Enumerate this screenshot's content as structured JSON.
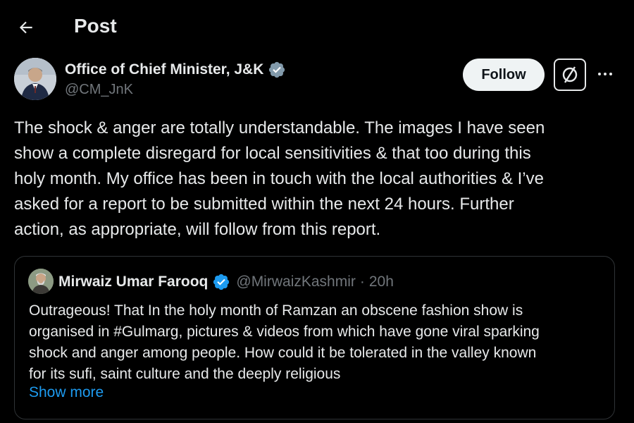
{
  "header": {
    "title": "Post",
    "back_icon": "arrow-left-icon"
  },
  "author": {
    "name": "Office of Chief Minister, J&K",
    "handle": "@CM_JnK",
    "verified_icon": "verified-badge-icon",
    "verified_color": "#829aab"
  },
  "actions": {
    "follow_label": "Follow",
    "grok_icon": "grok-icon",
    "more_icon": "more-dots-icon"
  },
  "post": {
    "lines": [
      "The shock & anger are totally understandable. The images I have seen",
      "show a complete disregard for local sensitivities & that too during this",
      "holy month. My office has been in touch with the local authorities & I’ve",
      "asked for a report to be submitted within the next 24 hours. Further",
      "action, as appropriate, will follow from this report."
    ]
  },
  "quote": {
    "name": "Mirwaiz Umar Farooq",
    "verified_color": "#1d9bf0",
    "handle": "@MirwaizKashmir",
    "separator": "·",
    "time": "20h",
    "lines": [
      "Outrageous! That In the holy month of Ramzan an obscene fashion show is",
      "organised in #Gulmarg, pictures & videos from which have gone viral sparking",
      "shock and anger among people. How could it be tolerated in the valley known",
      "for its sufi, saint culture and the deeply religious"
    ],
    "show_more": "Show more"
  },
  "colors": {
    "background": "#000000",
    "text": "#e7e9ea",
    "secondary_text": "#71767b",
    "link": "#1d9bf0",
    "border": "#2f3336"
  }
}
